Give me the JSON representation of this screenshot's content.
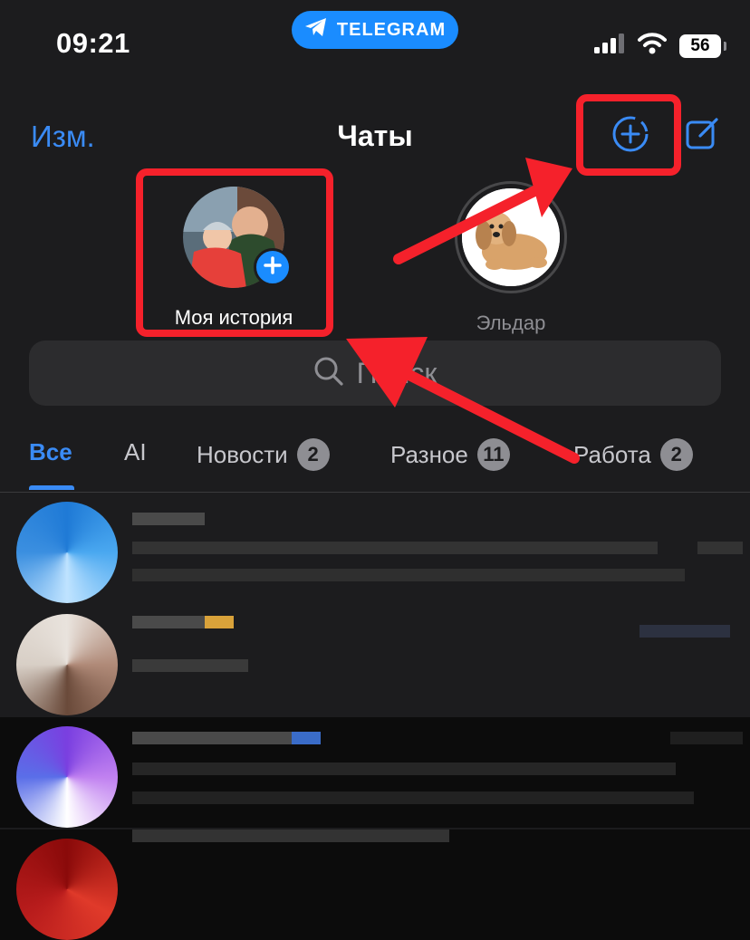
{
  "status": {
    "time": "09:21",
    "back_app": "TELEGRAM",
    "battery": "56"
  },
  "header": {
    "edit_label": "Изм.",
    "title": "Чаты"
  },
  "stories": [
    {
      "label": "Моя история"
    },
    {
      "label": "Эльдар"
    }
  ],
  "search": {
    "placeholder": "Поиск"
  },
  "tabs": [
    {
      "label": "Все",
      "active": true
    },
    {
      "label": "AI"
    },
    {
      "label": "Новости",
      "count": "2"
    },
    {
      "label": "Разное",
      "count": "11"
    },
    {
      "label": "Работа",
      "count": "2"
    }
  ],
  "colors": {
    "accent": "#3a8bf5",
    "pill": "#1a8cff",
    "annotation": "#f5212b",
    "background": "#1c1c1e"
  },
  "icons": [
    "telegram-icon",
    "signal-icon",
    "wifi-icon",
    "story-add-icon",
    "compose-icon",
    "search-icon",
    "plus-icon"
  ]
}
